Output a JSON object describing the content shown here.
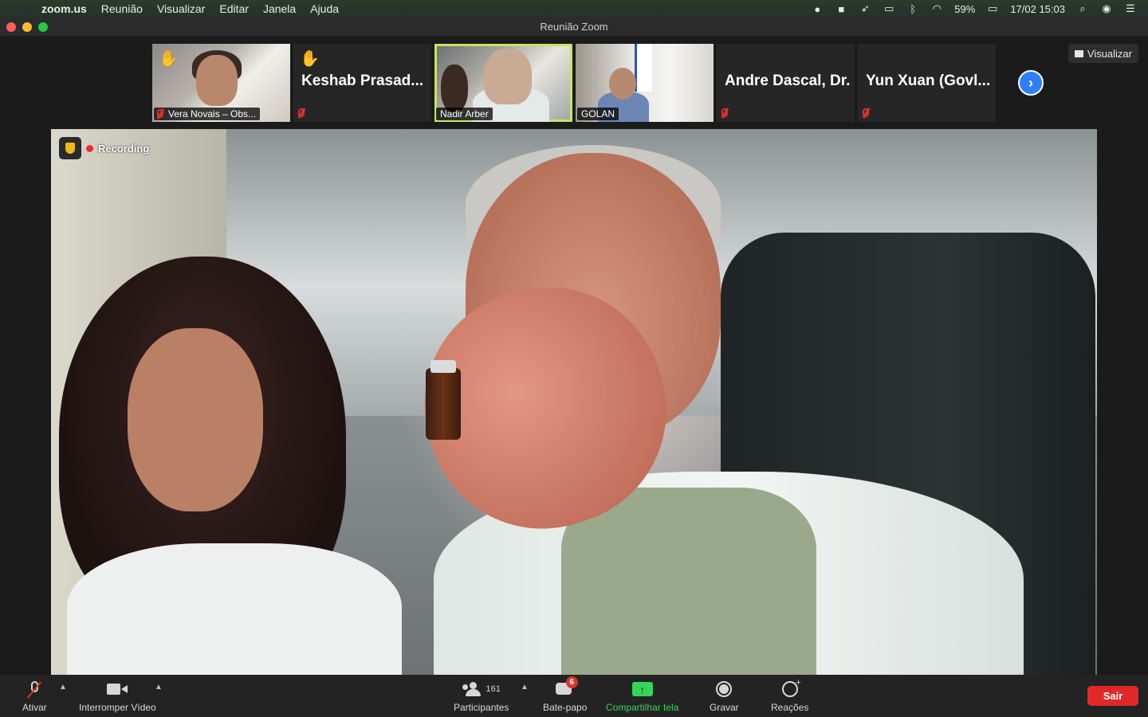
{
  "menubar": {
    "apple_glyph": "",
    "items": [
      "zoom.us",
      "Reunião",
      "Visualizar",
      "Editar",
      "Janela",
      "Ajuda"
    ],
    "battery": "59%",
    "datetime": "17/02  15:03"
  },
  "window": {
    "title": "Reunião Zoom"
  },
  "view_button": {
    "label": "Visualizar"
  },
  "participants_strip": [
    {
      "name": "Vera Novais – Obs...",
      "hand_raised": true,
      "muted": true,
      "has_video": true
    },
    {
      "name": "Keshab Prasad...",
      "hand_raised": true,
      "muted": true,
      "has_video": false
    },
    {
      "name": "Nadir Arber",
      "hand_raised": false,
      "muted": false,
      "has_video": true,
      "active_speaker": true
    },
    {
      "name": "GOLAN",
      "hand_raised": false,
      "muted": true,
      "has_video": true
    },
    {
      "name": "Andre Dascal, Dr.",
      "hand_raised": false,
      "muted": true,
      "has_video": false
    },
    {
      "name": "Yun Xuan (Govl...",
      "hand_raised": false,
      "muted": true,
      "has_video": false
    }
  ],
  "next_page_glyph": "›",
  "recording": {
    "label": "Recording"
  },
  "toolbar": {
    "unmute_label": "Ativar",
    "video_label": "Interromper Vídeo",
    "participants_label": "Participantes",
    "participants_count": "161",
    "chat_label": "Bate-papo",
    "chat_badge": "6",
    "share_label": "Compartilhar tela",
    "record_label": "Gravar",
    "reactions_label": "Reações",
    "leave_label": "Sair"
  },
  "colors": {
    "active_speaker_border": "#c9e265",
    "share_green": "#37d45a",
    "leave_red": "#e02828",
    "next_blue": "#2d7ff9"
  }
}
